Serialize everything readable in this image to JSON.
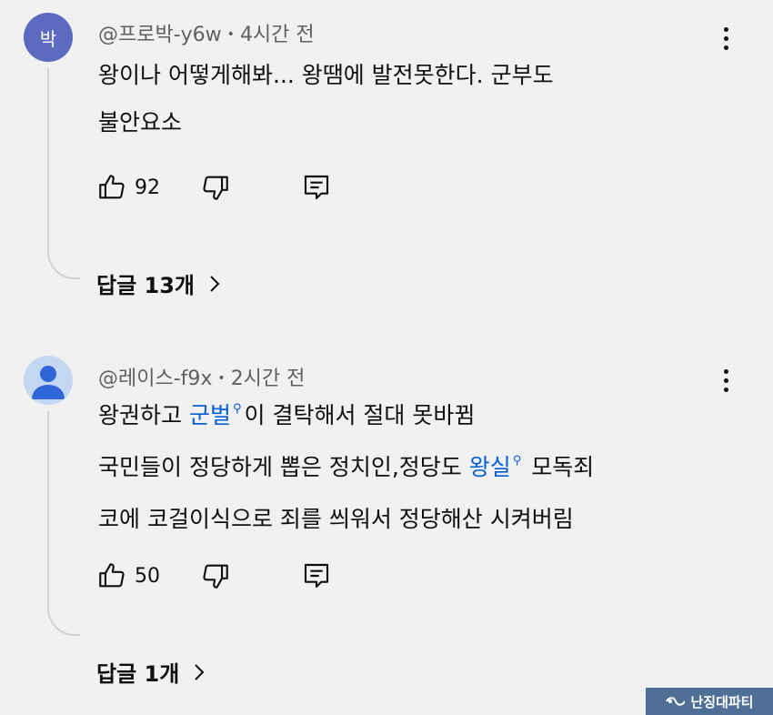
{
  "comments": [
    {
      "avatar_letter": "박",
      "avatar_color": "#5c6bc0",
      "handle": "@프로박-y6w",
      "time": "4시간 전",
      "lines": [
        {
          "segments": [
            {
              "text": "왕이나 어떻게해봐... 왕땜에 발전못한다. 군부도",
              "link": false
            }
          ]
        },
        {
          "segments": [
            {
              "text": "불안요소",
              "link": false
            }
          ]
        }
      ],
      "likes": "92",
      "replies_label": "답글 13개"
    },
    {
      "avatar_letter": "",
      "avatar_color": "#c5d8f3",
      "handle": "@레이스-f9x",
      "time": "2시간 전",
      "lines": [
        {
          "segments": [
            {
              "text": "왕권하고 ",
              "link": false
            },
            {
              "text": "군벌",
              "link": true
            },
            {
              "text": "이 결탁해서 절대 못바뀜",
              "link": false
            }
          ]
        },
        {
          "segments": [
            {
              "text": "국민들이 정당하게 뽑은 정치인,정당도 ",
              "link": false
            },
            {
              "text": "왕실",
              "link": true
            },
            {
              "text": " 모독죄",
              "link": false
            }
          ]
        },
        {
          "segments": [
            {
              "text": "코에 코걸이식으로 죄를 씌워서 정당해산 시켜버림",
              "link": false
            }
          ]
        }
      ],
      "likes": "50",
      "replies_label": "답글 1개"
    }
  ],
  "meta_separator": "•",
  "watermark": "난징대파티",
  "icons": {
    "like": "thumb-up-icon",
    "dislike": "thumb-down-icon",
    "reply": "reply-comment-icon",
    "menu": "more-vert-icon",
    "chevron": "chevron-right-icon",
    "search_link": "search-icon"
  },
  "colors": {
    "background": "#f1f1f1",
    "link": "#065fd4",
    "meta_text": "#606060"
  }
}
